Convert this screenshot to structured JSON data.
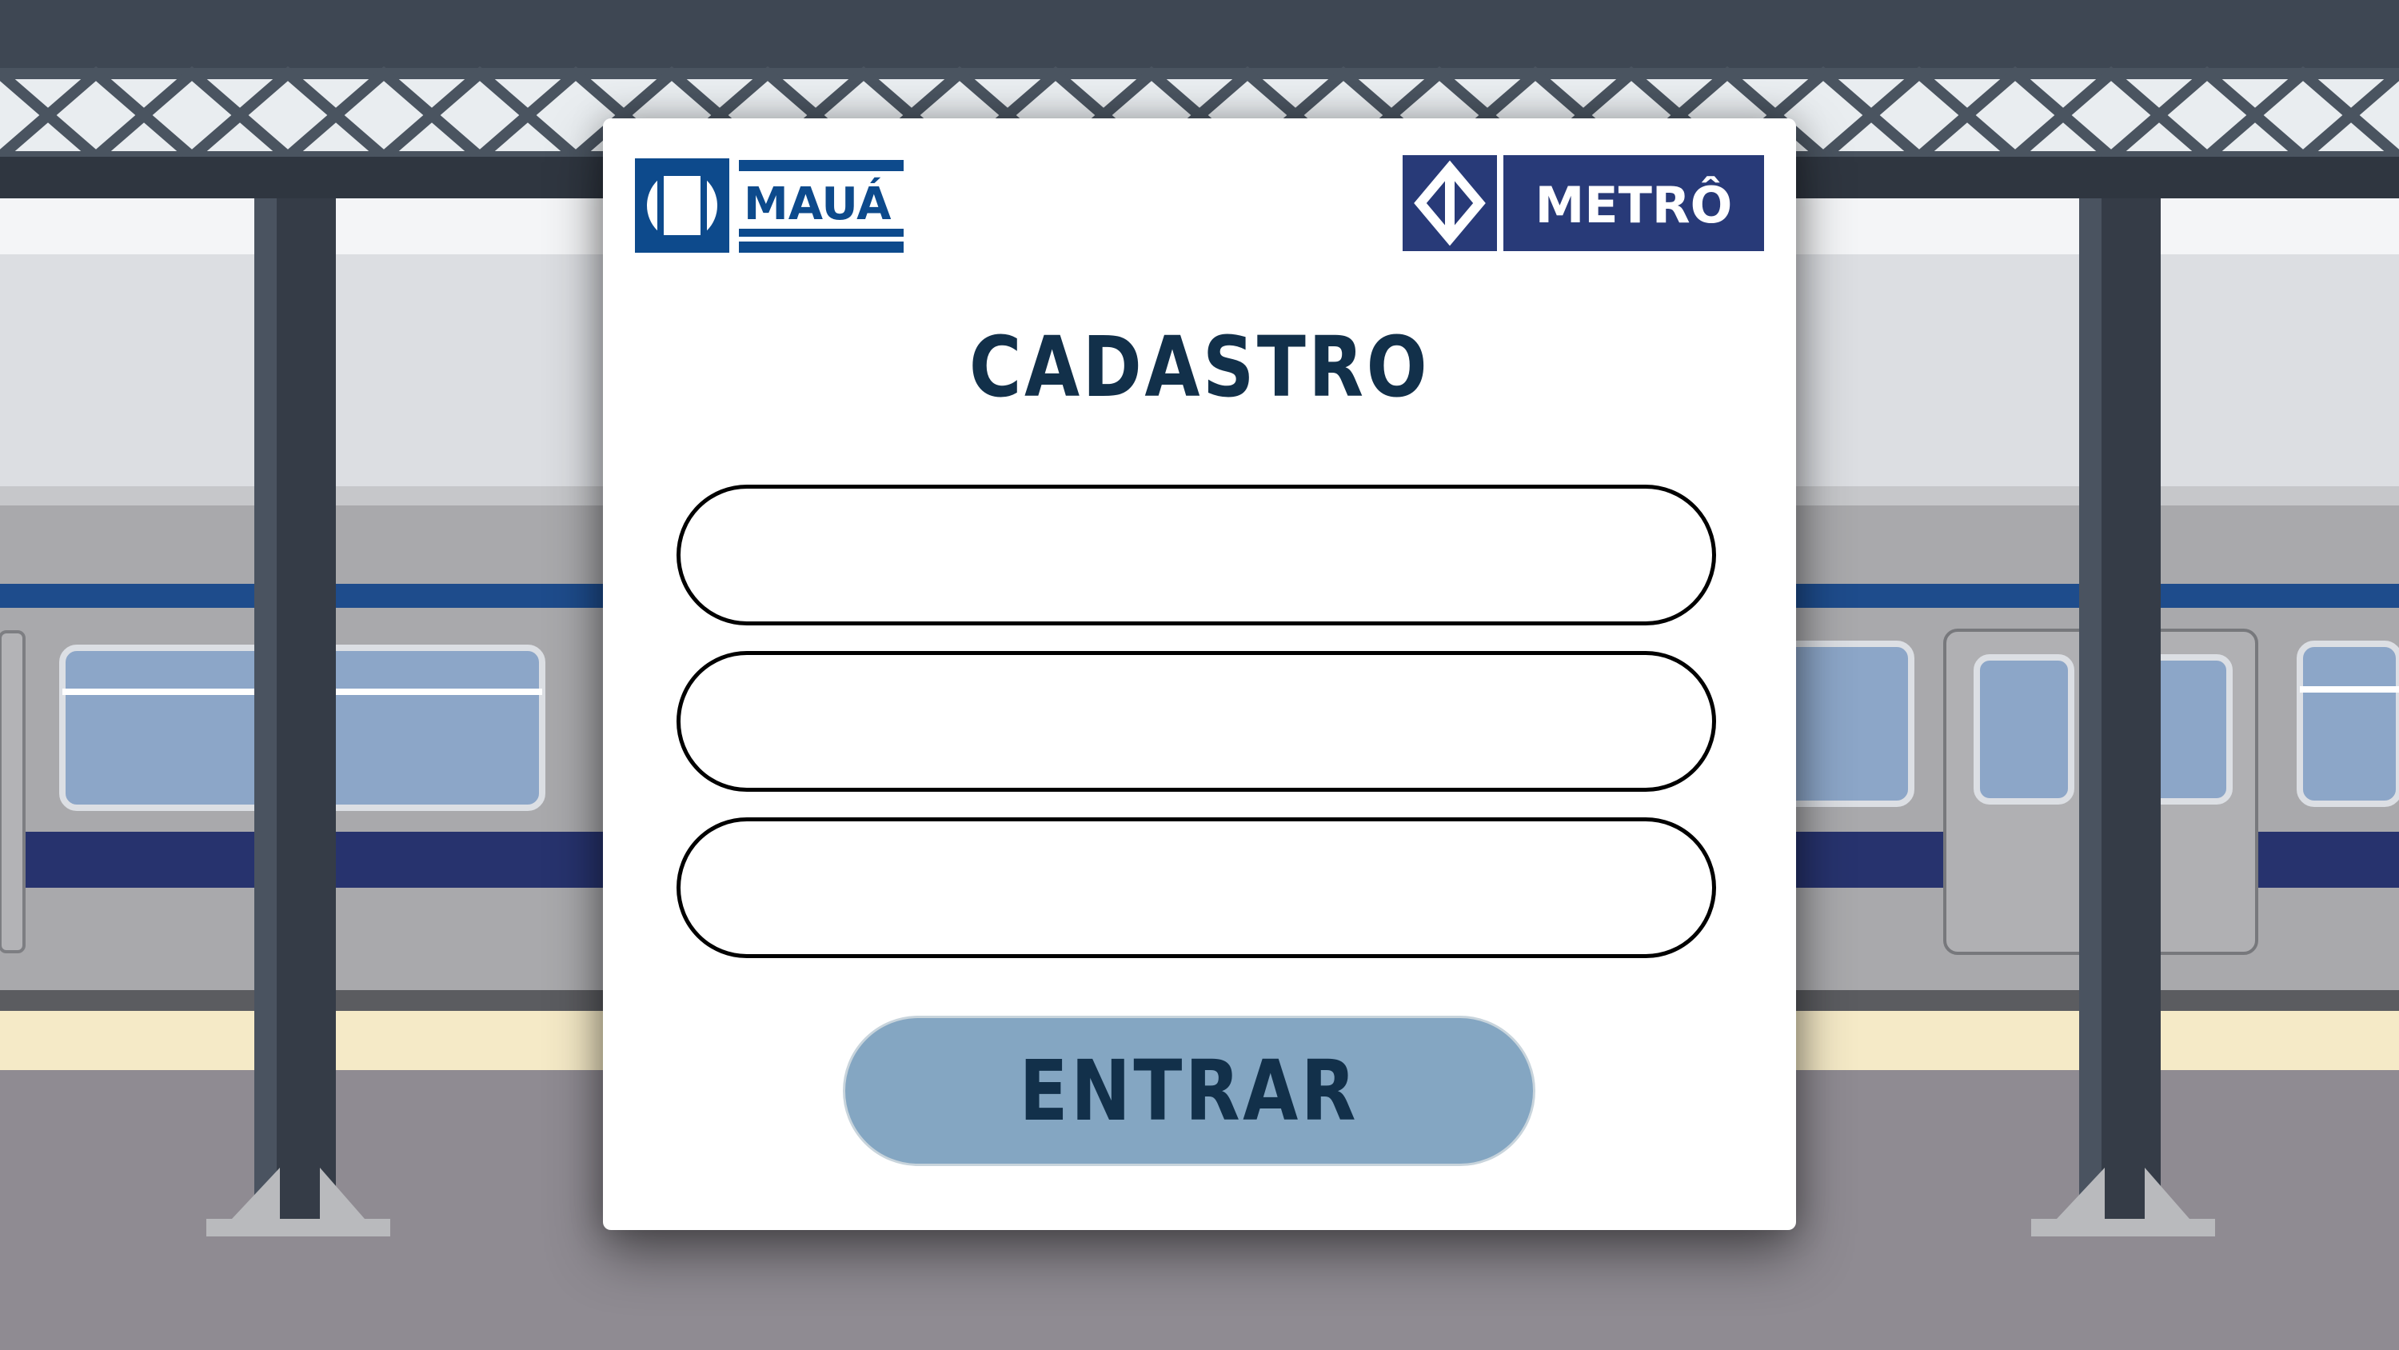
{
  "form": {
    "title": "CADASTRO",
    "submit_label": "ENTRAR",
    "fields": [
      {
        "value": "",
        "placeholder": ""
      },
      {
        "value": "",
        "placeholder": ""
      },
      {
        "value": "",
        "placeholder": ""
      }
    ]
  },
  "logos": {
    "left": {
      "text": "MAUÁ",
      "icon": "maua-emblem-icon"
    },
    "right": {
      "text": "METRÔ",
      "icon": "metro-arrows-icon"
    }
  },
  "colors": {
    "title_text": "#12304a",
    "button_fill": "#84a6c2",
    "logo_blue": "#0d4a8c",
    "metro_navy": "#283a78"
  }
}
